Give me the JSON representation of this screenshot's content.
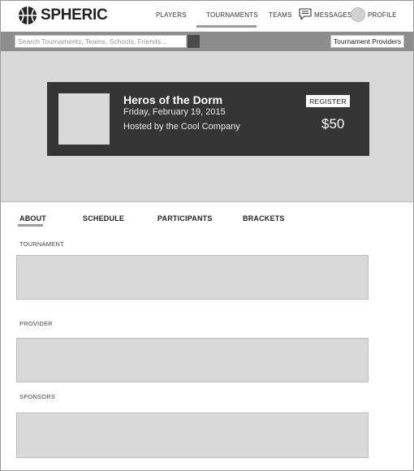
{
  "brand": {
    "name": "SPHERIC"
  },
  "nav": {
    "players": "PLAYERS",
    "tournaments": "TOURNAMENTS",
    "teams": "TEAMS",
    "messages": "MESSAGES",
    "profile": "PROFILE",
    "active": "TOURNAMENTS"
  },
  "search": {
    "placeholder": "Search Tournaments, Teams, Schools, Friends...",
    "providers_label": "Tournament Providers"
  },
  "event": {
    "title": "Heros of the Dorm",
    "date": "Friday, February 19, 2015",
    "host": "Hosted by the Cool Company",
    "register_label": "REGISTER",
    "price": "$50"
  },
  "tabs": {
    "items": [
      "ABOUT",
      "SCHEDULE",
      "PARTICIPANTS",
      "BRACKETS"
    ],
    "active": "ABOUT"
  },
  "sections": {
    "tournament": "TOURNAMENT",
    "provider": "PROVIDER",
    "sponsors": "SPONSORS"
  },
  "icons": {
    "logo": "basketball-icon",
    "messages": "chat-bubble-icon",
    "search": "search-icon"
  },
  "colors": {
    "card_background": "#353535",
    "hero_background": "#d9d9d9",
    "search_bar": "#8d8d8d",
    "active_indicator": "#9c9c9c"
  }
}
